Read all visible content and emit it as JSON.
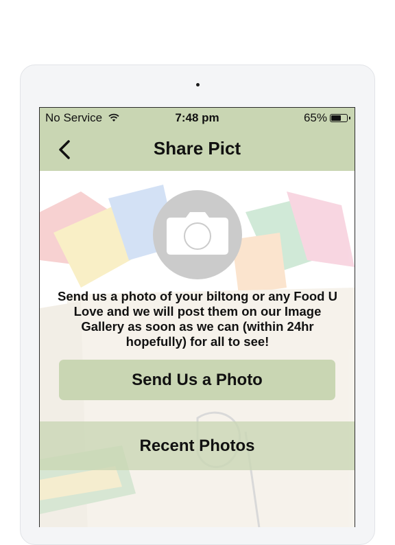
{
  "status_bar": {
    "carrier": "No Service",
    "time": "7:48 pm",
    "battery_percent": "65%",
    "battery_level": 0.65,
    "wifi_icon": "wifi-icon"
  },
  "nav": {
    "title": "Share Pict",
    "back_icon": "chevron-left-icon"
  },
  "main": {
    "camera_icon": "camera-icon",
    "message": "Send us a photo of  your biltong or any Food U Love and we will post them on our Image Gallery as soon as we can (within 24hr hopefully) for all to see!",
    "send_button_label": "Send Us a Photo",
    "recent_button_label": "Recent Photos"
  },
  "colors": {
    "accent_green": "#c9d6b3",
    "camera_circle": "#cbcbcb"
  }
}
